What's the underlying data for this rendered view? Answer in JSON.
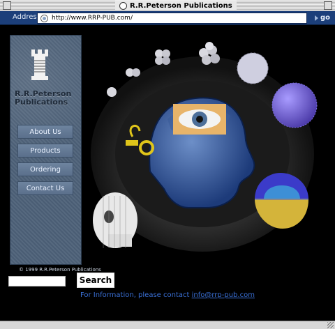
{
  "window": {
    "title": "R.R.Peterson Publications"
  },
  "address": {
    "label": "Address:",
    "url": "http://www.RRP-PUB.com/",
    "go_label": "go"
  },
  "sidebar": {
    "brand_line1": "R.R.Peterson",
    "brand_line2": "Publications",
    "nav": [
      {
        "label": "About Us"
      },
      {
        "label": "Products"
      },
      {
        "label": "Ordering"
      },
      {
        "label": "Contact Us"
      }
    ],
    "copyright": "© 1999 R.R.Peterson Publications"
  },
  "search": {
    "value": "",
    "button_label": "Search"
  },
  "info": {
    "prefix": "For Information, please contact",
    "email": "info@rrp-pub.com"
  },
  "colors": {
    "chrome_blue": "#1c3f7a",
    "sidebar": "#4a5d74",
    "link": "#3a70d6"
  },
  "icons": {
    "logo": "chess-rook-icon",
    "go": "go-arrow-icon",
    "url": "globe-icon"
  }
}
